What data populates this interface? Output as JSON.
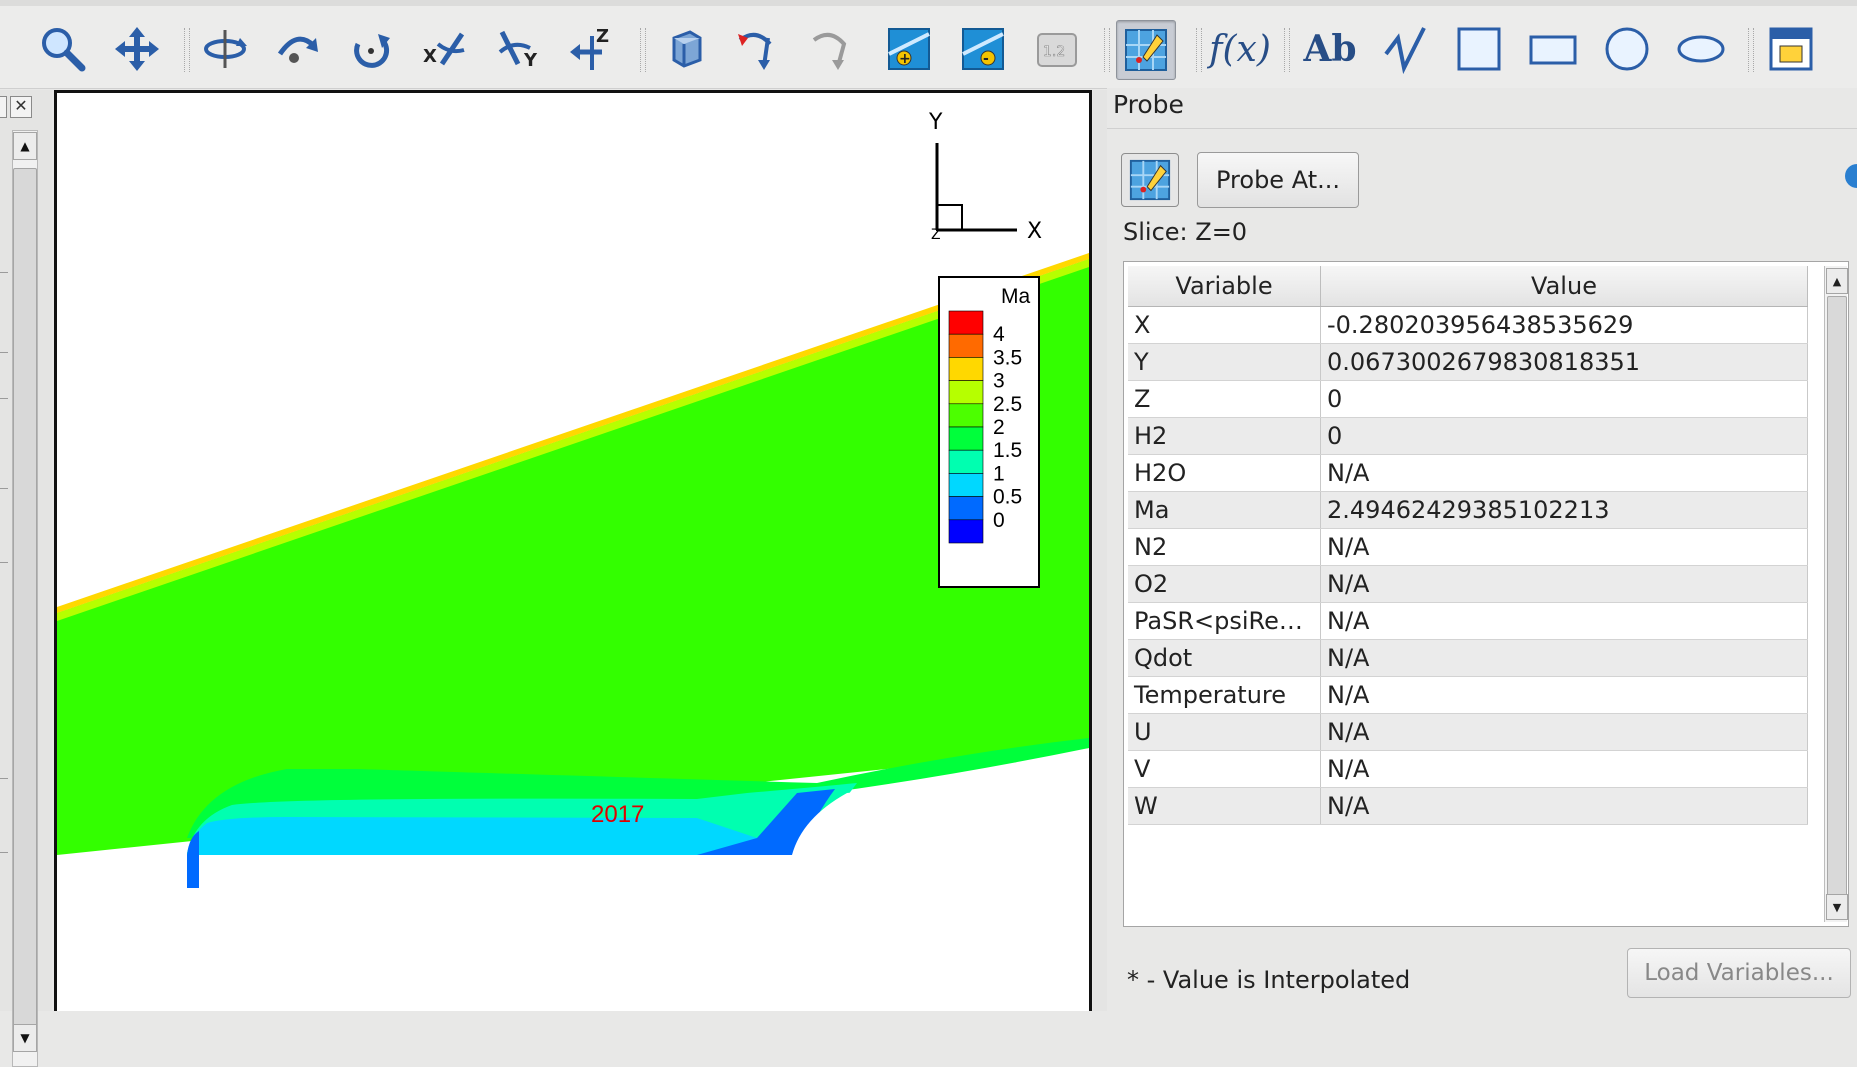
{
  "probe": {
    "title": "Probe",
    "probe_at_label": "Probe At...",
    "slice_label": "Slice: Z=0",
    "columns": [
      "Variable",
      "Value"
    ],
    "rows": [
      {
        "variable": "X",
        "value": "-0.280203956438535629"
      },
      {
        "variable": "Y",
        "value": "0.0673002679830818351"
      },
      {
        "variable": "Z",
        "value": "0"
      },
      {
        "variable": "H2",
        "value": "0"
      },
      {
        "variable": "H2O",
        "value": "N/A"
      },
      {
        "variable": "Ma",
        "value": "2.49462429385102213"
      },
      {
        "variable": "N2",
        "value": "N/A"
      },
      {
        "variable": "O2",
        "value": "N/A"
      },
      {
        "variable": "PaSR<psiReact...",
        "value": "N/A"
      },
      {
        "variable": "Qdot",
        "value": "N/A"
      },
      {
        "variable": "Temperature",
        "value": "N/A"
      },
      {
        "variable": "U",
        "value": "N/A"
      },
      {
        "variable": "V",
        "value": "N/A"
      },
      {
        "variable": "W",
        "value": "N/A"
      }
    ],
    "interp_note": "* - Value is Interpolated",
    "load_variables_label": "Load Variables..."
  },
  "plot": {
    "axis_y_label": "Y",
    "axis_x_label": "X",
    "axis_z_label": "Z",
    "annotation": "2017",
    "legend": {
      "title": "Ma",
      "levels": [
        "4",
        "3.5",
        "3",
        "2.5",
        "2",
        "1.5",
        "1",
        "0.5",
        "0"
      ],
      "colors": [
        "#ff0000",
        "#ff6a00",
        "#ffd800",
        "#b6ff00",
        "#4cff00",
        "#00ff3b",
        "#00ffb0",
        "#00d8ff",
        "#006aff",
        "#0000ff"
      ]
    },
    "field_color": "#33ff00"
  },
  "toolbar": {
    "icons": [
      "zoom-icon",
      "translate-icon",
      "rotate-spherical-icon",
      "rotate-rollerball-icon",
      "rotate-twist-icon",
      "rotate-x-icon",
      "rotate-y-icon",
      "rotate-z-icon",
      "3d-box-icon",
      "contour-probe-icon",
      "streamtrace-icon",
      "slice-add-icon",
      "slice-remove-icon",
      "numbered-tool-icon",
      "probe-icon",
      "fx-text-icon",
      "text-icon",
      "polyline-icon",
      "square-icon",
      "rectangle-icon",
      "circle-icon",
      "ellipse-icon",
      "frame-icon"
    ],
    "fx_label": "f(x)",
    "ab_label": "Ab"
  }
}
